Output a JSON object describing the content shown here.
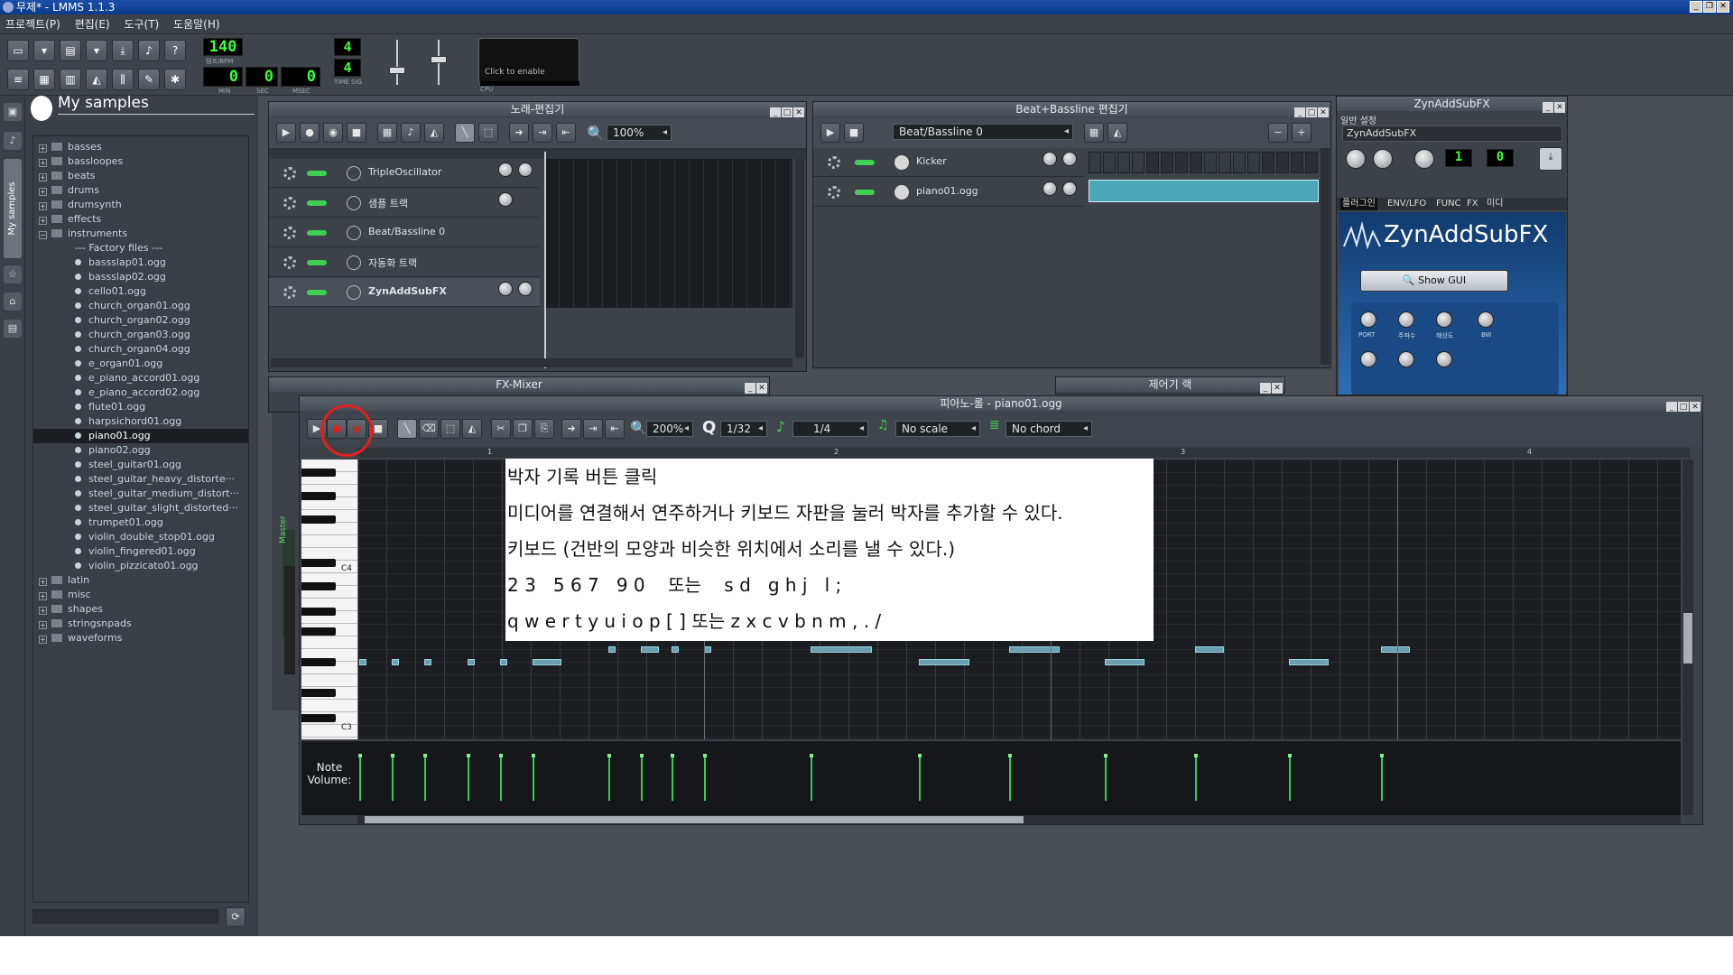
{
  "window": {
    "title": "무제* - LMMS 1.1.3"
  },
  "menu": [
    "프로젝트(P)",
    "편집(E)",
    "도구(T)",
    "도움말(H)"
  ],
  "toolbar": {
    "tempo": "140",
    "tempo_label": "템포/BPM",
    "min": "0",
    "sec": "0",
    "msec": "0",
    "min_label": "MIN",
    "sec_label": "SEC",
    "msec_label": "MSEC",
    "timesig_num": "4",
    "timesig_den": "4",
    "timesig_label": "TIME SIG",
    "cpu_hint": "Click to enable",
    "cpu_label": "CPU"
  },
  "browser": {
    "title": "My samples",
    "tab_label": "My samples",
    "items": [
      {
        "label": "basses",
        "type": "folder"
      },
      {
        "label": "bassloopes",
        "type": "folder"
      },
      {
        "label": "beats",
        "type": "folder"
      },
      {
        "label": "drums",
        "type": "folder"
      },
      {
        "label": "drumsynth",
        "type": "folder"
      },
      {
        "label": "effects",
        "type": "folder"
      },
      {
        "label": "instruments",
        "type": "folder-open"
      },
      {
        "label": "--- Factory files ---",
        "type": "header"
      },
      {
        "label": "bassslap01.ogg",
        "type": "file"
      },
      {
        "label": "bassslap02.ogg",
        "type": "file"
      },
      {
        "label": "cello01.ogg",
        "type": "file"
      },
      {
        "label": "church_organ01.ogg",
        "type": "file"
      },
      {
        "label": "church_organ02.ogg",
        "type": "file"
      },
      {
        "label": "church_organ03.ogg",
        "type": "file"
      },
      {
        "label": "church_organ04.ogg",
        "type": "file"
      },
      {
        "label": "e_organ01.ogg",
        "type": "file"
      },
      {
        "label": "e_piano_accord01.ogg",
        "type": "file"
      },
      {
        "label": "e_piano_accord02.ogg",
        "type": "file"
      },
      {
        "label": "flute01.ogg",
        "type": "file"
      },
      {
        "label": "harpsichord01.ogg",
        "type": "file"
      },
      {
        "label": "piano01.ogg",
        "type": "file",
        "selected": true
      },
      {
        "label": "piano02.ogg",
        "type": "file"
      },
      {
        "label": "steel_guitar01.ogg",
        "type": "file"
      },
      {
        "label": "steel_guitar_heavy_distorte···",
        "type": "file"
      },
      {
        "label": "steel_guitar_medium_distort···",
        "type": "file"
      },
      {
        "label": "steel_guitar_slight_distorted···",
        "type": "file"
      },
      {
        "label": "trumpet01.ogg",
        "type": "file"
      },
      {
        "label": "violin_double_stop01.ogg",
        "type": "file"
      },
      {
        "label": "violin_fingered01.ogg",
        "type": "file"
      },
      {
        "label": "violin_pizzicato01.ogg",
        "type": "file"
      },
      {
        "label": "latin",
        "type": "folder"
      },
      {
        "label": "misc",
        "type": "folder"
      },
      {
        "label": "shapes",
        "type": "folder"
      },
      {
        "label": "stringsnpads",
        "type": "folder"
      },
      {
        "label": "waveforms",
        "type": "folder"
      }
    ]
  },
  "song_editor": {
    "title": "노래-편집기",
    "zoom": "100%",
    "tracks": [
      "TripleOscillator",
      "샘플 트랙",
      "Beat/Bassline 0",
      "자동화 트랙",
      "ZynAddSubFX"
    ]
  },
  "bb_editor": {
    "title": "Beat+Bassline 편집기",
    "pattern": "Beat/Bassline 0",
    "tracks": [
      "Kicker",
      "piano01.ogg"
    ]
  },
  "zyn": {
    "title": "ZynAddSubFX",
    "section": "일반 설정",
    "name_field": "ZynAddSubFX",
    "fx_value": "0",
    "tabs": [
      "플러그인",
      "ENV/LFO",
      "FUNC",
      "FX",
      "미디"
    ],
    "logo": "ZynAddSubFX",
    "show_gui": "Show GUI",
    "knobs": [
      "PORT",
      "주파수",
      "해상도",
      "BW"
    ]
  },
  "fx_mixer": {
    "title": "FX-Mixer",
    "master": "Master"
  },
  "controller_rack": {
    "title": "제어기 랙"
  },
  "piano_roll": {
    "title": "피아노-롤 - piano01.ogg",
    "zoom": "200%",
    "quantize": "1/32",
    "note_length": "1/4",
    "scale": "No scale",
    "chord": "No chord",
    "bar_numbers": [
      "1",
      "2",
      "3",
      "4"
    ],
    "key_labels": [
      "C4",
      "C3"
    ],
    "volume_label": "Note Volume:"
  },
  "callout": {
    "lines": [
      "박자 기록 버튼 클릭",
      "미디어를 연결해서 연주하거나 키보드 자판을 눌러 박자를 추가할 수 있다.",
      "키보드 (건반의 모양과 비슷한 위치에서 소리를 낼 수 있다.)",
      "2 3   5 6 7   9 0    또는    s d   g h j   l ;",
      "q w e r t y u i o p [ ] 또는 z x c v b n m , . /"
    ]
  },
  "colors": {
    "accent_note": "#6a9fae",
    "volume_bar": "#2ecc5a",
    "highlight": "#e02020",
    "lcd": "#3cff3c"
  }
}
